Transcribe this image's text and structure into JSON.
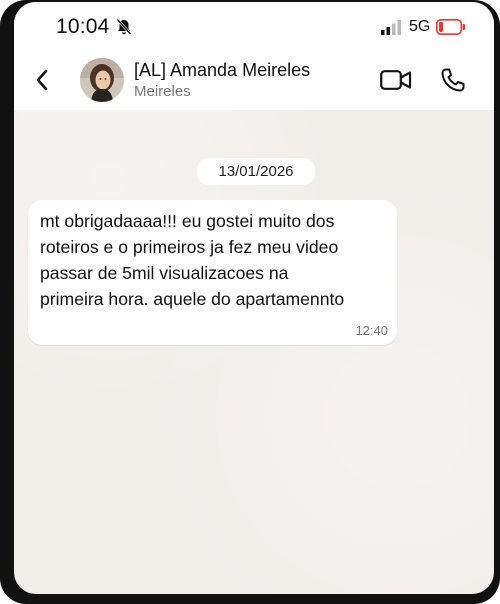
{
  "status_bar": {
    "time": "10:04",
    "mute_icon": "bell-slash-icon",
    "signal_icon": "signal-bars-icon",
    "network": "5G",
    "battery_icon": "battery-low-icon",
    "battery_color": "#e53935"
  },
  "chat_header": {
    "back_icon": "chevron-left-icon",
    "contact_name": "[AL] Amanda Meireles",
    "contact_subtitle": "Meireles",
    "video_icon": "video-camera-icon",
    "call_icon": "phone-icon"
  },
  "conversation": {
    "date_label": "13/01/2026",
    "messages": [
      {
        "text": "mt obrigadaaaa!!! eu gostei muito dos\nroteiros e o primeiros ja fez meu video\npassar de 5mil visualizacoes na\nprimeira hora. aquele do apartamennto",
        "time": "12:40"
      }
    ]
  },
  "colors": {
    "chat_background": "#f1eeea",
    "bubble": "#ffffff",
    "header": "#ffffff",
    "frame": "#111111"
  }
}
